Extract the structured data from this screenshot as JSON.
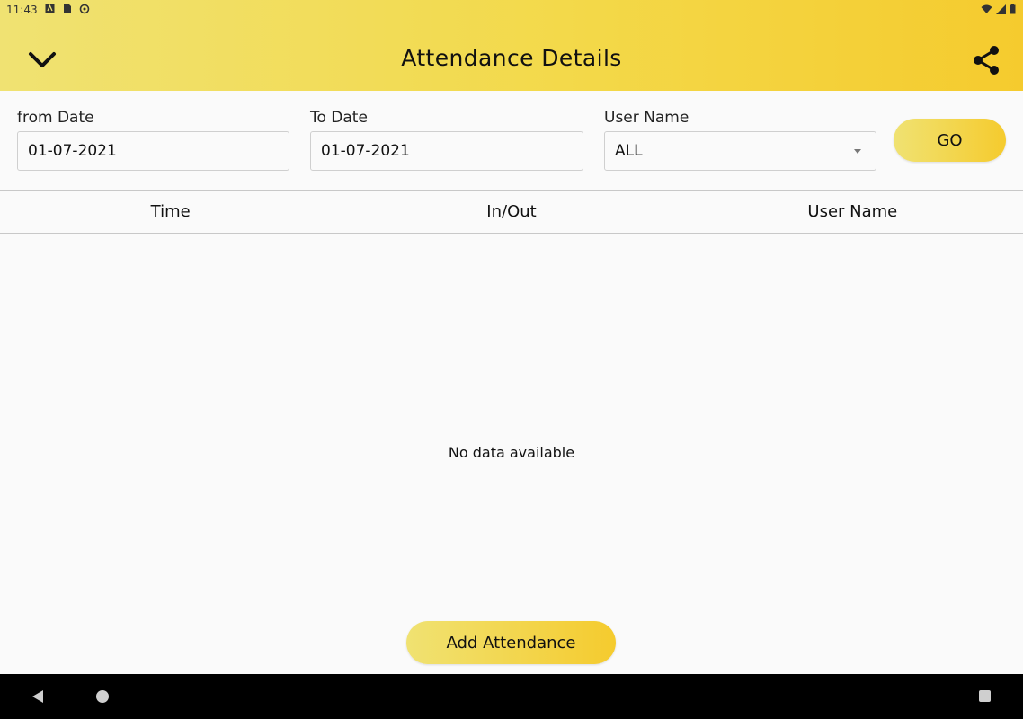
{
  "status_bar": {
    "time": "11:43",
    "left_icons": [
      "accessibility-icon",
      "sd-card-icon",
      "sync-icon"
    ],
    "right_icons": [
      "wifi-icon",
      "signal-icon",
      "battery-icon"
    ]
  },
  "appbar": {
    "title": "Attendance Details",
    "back_icon": "chevron-down-icon",
    "share_icon": "share-icon"
  },
  "filters": {
    "from_date": {
      "label": "from Date",
      "value": "01-07-2021"
    },
    "to_date": {
      "label": "To Date",
      "value": "01-07-2021"
    },
    "user_name": {
      "label": "User Name",
      "value": "ALL"
    },
    "go_label": "GO"
  },
  "table": {
    "columns": [
      "Time",
      "In/Out",
      "User Name"
    ],
    "rows": [],
    "empty_message": "No data available"
  },
  "actions": {
    "add_attendance_label": "Add Attendance"
  },
  "colors": {
    "accent_start": "#f0e272",
    "accent_end": "#f5cb2e",
    "background": "#fafafa",
    "nav_bar": "#000000"
  }
}
